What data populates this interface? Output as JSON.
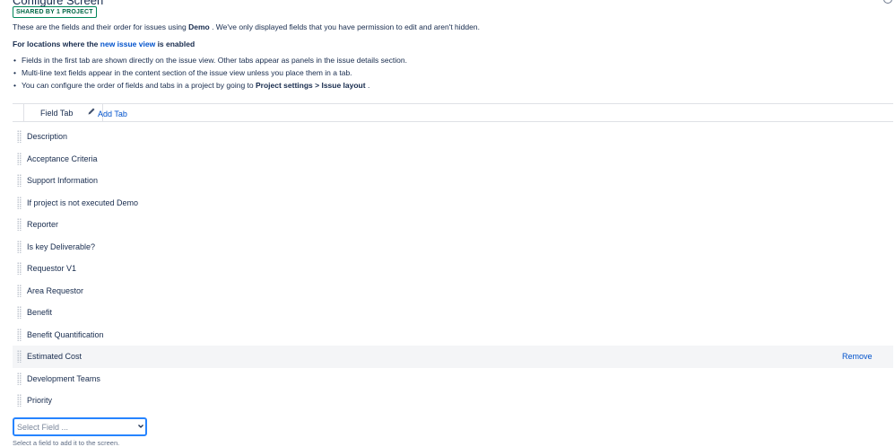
{
  "header": {
    "title": "Configure Screen",
    "badge": "SHARED BY 1 PROJECT"
  },
  "intro": {
    "before": "These are the fields and their order for issues using ",
    "project": "Demo",
    "after": " . We've only displayed fields that you have permission to edit and aren't hidden."
  },
  "locations": {
    "before": "For locations where the ",
    "link": "new issue view",
    "after": " is enabled"
  },
  "bullets": {
    "b1": "Fields in the first tab are shown directly on the issue view. Other tabs appear as panels in the issue details section.",
    "b2": "Multi-line text fields appear in the content section of the issue view unless you place them in a tab.",
    "b3_before": "You can configure the order of fields and tabs in a project by going to ",
    "b3_bold": "Project settings > Issue layout",
    "b3_after": " ."
  },
  "tabs": {
    "active": "Field Tab",
    "add": "Add Tab"
  },
  "fields": [
    "Description",
    "Acceptance Criteria",
    "Support Information",
    "If project is not executed Demo",
    "Reporter",
    "Is key Deliverable?",
    "Requestor V1",
    "Area Requestor",
    "Benefit",
    "Benefit Quantification",
    "Estimated Cost",
    "Development Teams",
    "Priority"
  ],
  "remove_label": "Remove",
  "select": {
    "placeholder": "Select Field ...",
    "hint": "Select a field to add it to the screen."
  }
}
